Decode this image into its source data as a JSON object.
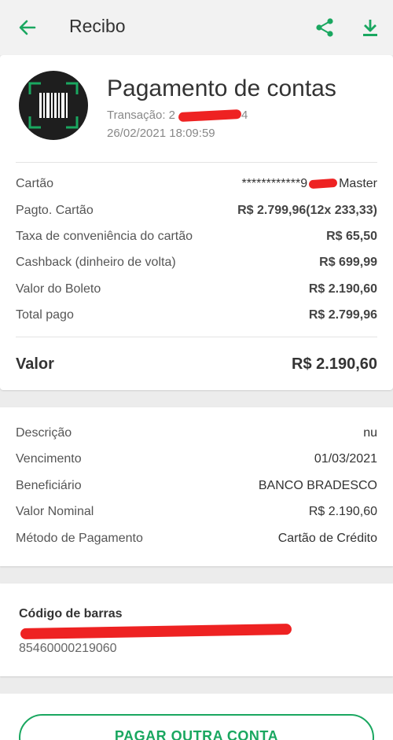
{
  "header": {
    "title": "Recibo",
    "back_icon": "arrow-left-icon",
    "share_icon": "share-icon",
    "download_icon": "download-icon",
    "accent_color": "#1aa760"
  },
  "summary": {
    "icon": "barcode-scan-icon",
    "heading": "Pagamento de contas",
    "transaction_label": "Transação: 2",
    "transaction_suffix": "4",
    "date": "26/02/2021 18:09:59"
  },
  "payment_details": [
    {
      "label": "Cartão",
      "value_prefix": "************9",
      "value_suffix": "Master"
    },
    {
      "label": "Pagto. Cartão",
      "value": "R$ 2.799,96(12x 233,33)"
    },
    {
      "label": "Taxa de conveniência do cartão",
      "value": "R$ 65,50"
    },
    {
      "label": "Cashback (dinheiro de volta)",
      "value": "R$ 699,99"
    },
    {
      "label": "Valor do Boleto",
      "value": "R$ 2.190,60"
    },
    {
      "label": "Total pago",
      "value": "R$ 2.799,96"
    }
  ],
  "total": {
    "label": "Valor",
    "value": "R$ 2.190,60"
  },
  "bill_details": [
    {
      "label": "Descrição",
      "value": "nu"
    },
    {
      "label": "Vencimento",
      "value": "01/03/2021"
    },
    {
      "label": "Beneficiário",
      "value": "BANCO BRADESCO"
    },
    {
      "label": "Valor Nominal",
      "value": "R$ 2.190,60"
    },
    {
      "label": "Método de Pagamento",
      "value": "Cartão de Crédito"
    }
  ],
  "barcode": {
    "label": "Código de barras",
    "number": "85460000219060"
  },
  "actions": {
    "pay_another_label": "PAGAR OUTRA CONTA"
  }
}
